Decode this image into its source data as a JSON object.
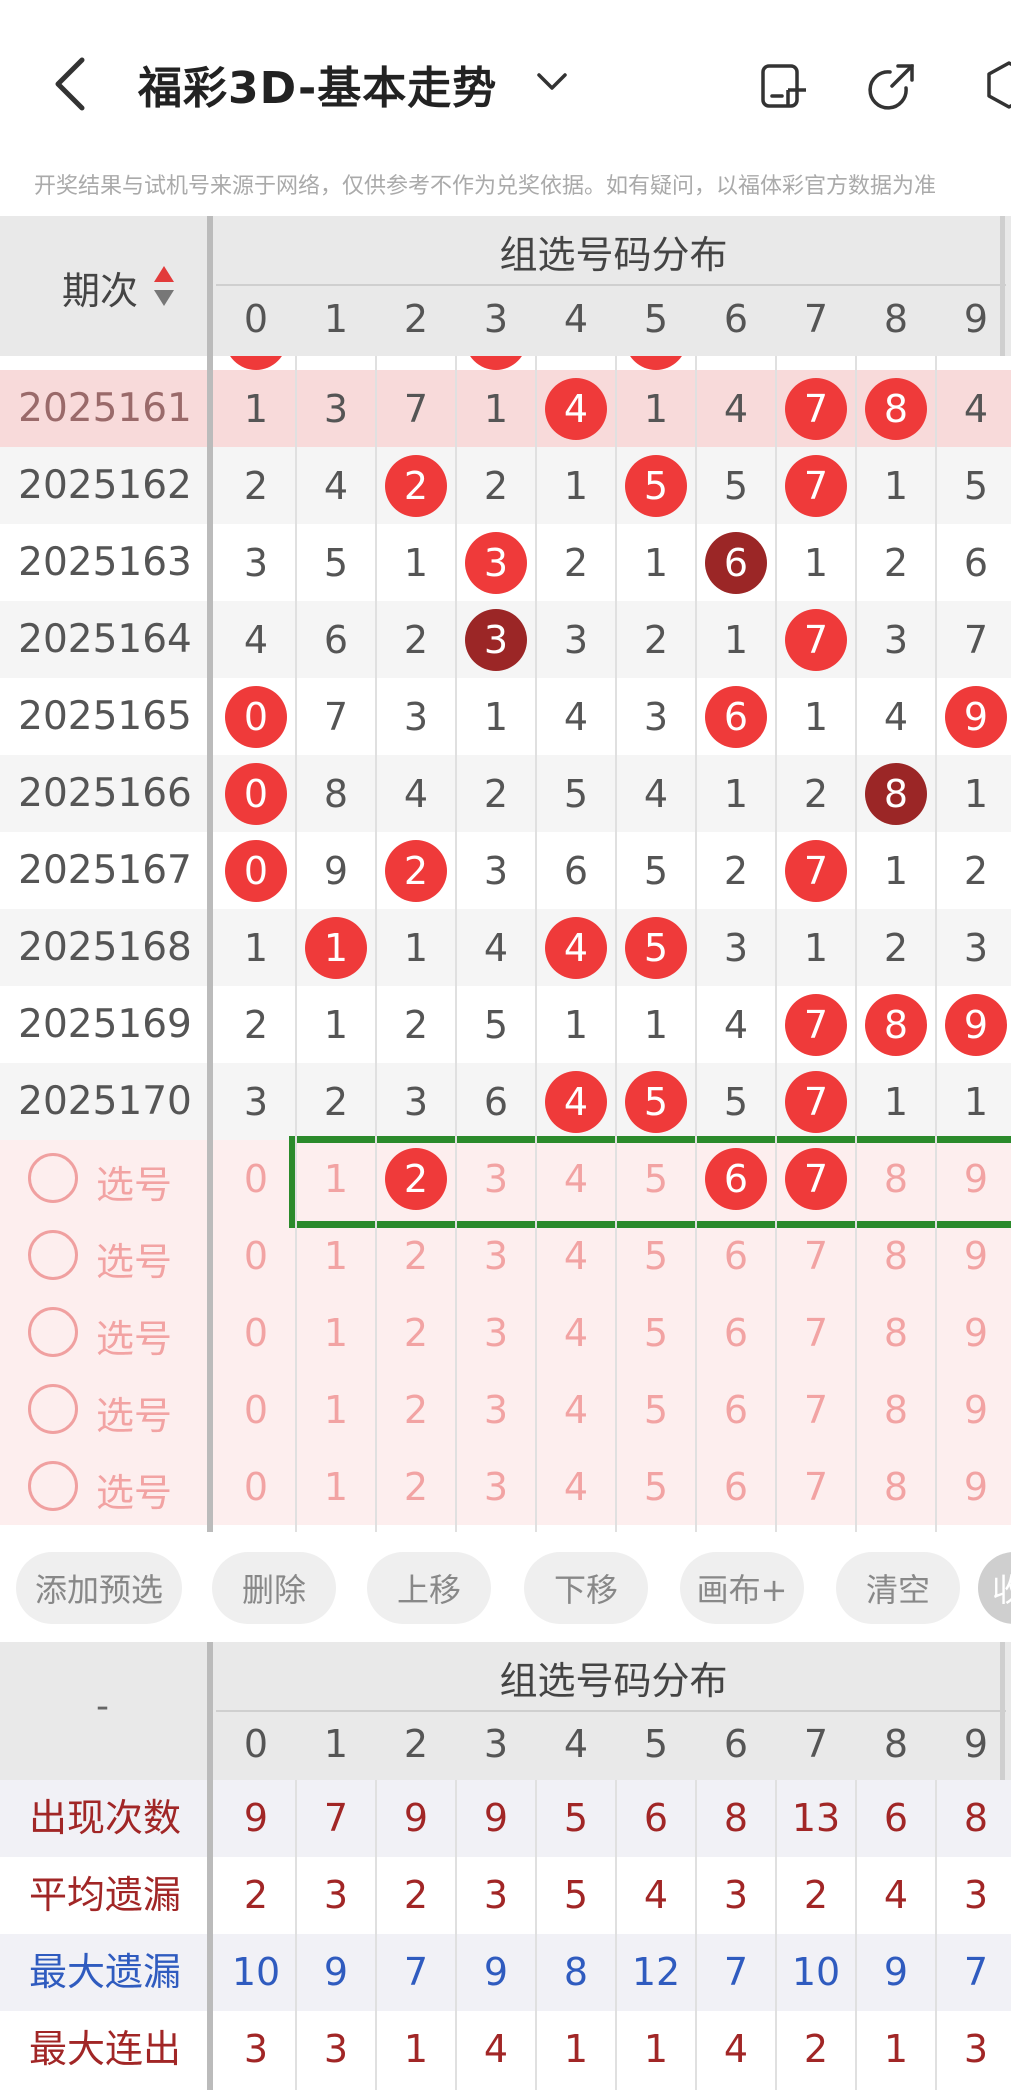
{
  "header": {
    "title": "福彩3D-基本走势",
    "notice": "开奖结果与试机号来源于网络，仅供参考不作为兑奖依据。如有疑问，以福体彩官方数据为准"
  },
  "table": {
    "period_header": "期次",
    "group_title": "组选号码分布",
    "digits": [
      "0",
      "1",
      "2",
      "3",
      "4",
      "5",
      "6",
      "7",
      "8",
      "9"
    ],
    "rows": [
      {
        "period": "2025161",
        "cells": [
          "1",
          "3",
          "7",
          "1",
          "4",
          "1",
          "4",
          "7",
          "8",
          "4"
        ],
        "hits": [
          4,
          7,
          8
        ],
        "dark": []
      },
      {
        "period": "2025162",
        "cells": [
          "2",
          "4",
          "2",
          "2",
          "1",
          "5",
          "5",
          "7",
          "1",
          "5"
        ],
        "hits": [
          2,
          5,
          7
        ],
        "dark": []
      },
      {
        "period": "2025163",
        "cells": [
          "3",
          "5",
          "1",
          "3",
          "2",
          "1",
          "6",
          "1",
          "2",
          "6"
        ],
        "hits": [
          3
        ],
        "dark": [
          6
        ]
      },
      {
        "period": "2025164",
        "cells": [
          "4",
          "6",
          "2",
          "3",
          "3",
          "2",
          "1",
          "7",
          "3",
          "7"
        ],
        "hits": [
          7
        ],
        "dark": [
          3
        ]
      },
      {
        "period": "2025165",
        "cells": [
          "0",
          "7",
          "3",
          "1",
          "4",
          "3",
          "6",
          "1",
          "4",
          "9"
        ],
        "hits": [
          0,
          6,
          9
        ],
        "dark": []
      },
      {
        "period": "2025166",
        "cells": [
          "0",
          "8",
          "4",
          "2",
          "5",
          "4",
          "1",
          "2",
          "8",
          "1"
        ],
        "hits": [
          0
        ],
        "dark": [
          8
        ]
      },
      {
        "period": "2025167",
        "cells": [
          "0",
          "9",
          "2",
          "3",
          "6",
          "5",
          "2",
          "7",
          "1",
          "2"
        ],
        "hits": [
          0,
          2,
          7
        ],
        "dark": []
      },
      {
        "period": "2025168",
        "cells": [
          "1",
          "1",
          "1",
          "4",
          "4",
          "5",
          "3",
          "1",
          "2",
          "3"
        ],
        "hits": [
          1,
          4,
          5
        ],
        "dark": []
      },
      {
        "period": "2025169",
        "cells": [
          "2",
          "1",
          "2",
          "5",
          "1",
          "1",
          "4",
          "7",
          "8",
          "9"
        ],
        "hits": [
          7,
          8,
          9
        ],
        "dark": []
      },
      {
        "period": "2025170",
        "cells": [
          "3",
          "2",
          "3",
          "6",
          "4",
          "5",
          "5",
          "7",
          "1",
          "1"
        ],
        "hits": [
          4,
          5,
          7
        ],
        "dark": []
      }
    ]
  },
  "selection": {
    "label": "选号",
    "rows": [
      {
        "selected": [
          2,
          6,
          7
        ]
      },
      {
        "selected": []
      },
      {
        "selected": []
      },
      {
        "selected": []
      },
      {
        "selected": []
      }
    ]
  },
  "toolbar": {
    "buttons": [
      "添加预选",
      "删除",
      "上移",
      "下移",
      "画布+",
      "清空",
      "收"
    ]
  },
  "stats": {
    "corner": "-",
    "group_title": "组选号码分布",
    "digits": [
      "0",
      "1",
      "2",
      "3",
      "4",
      "5",
      "6",
      "7",
      "8",
      "9"
    ],
    "rows": [
      {
        "label": "出现次数",
        "values": [
          "9",
          "7",
          "9",
          "9",
          "5",
          "6",
          "8",
          "13",
          "6",
          "8"
        ]
      },
      {
        "label": "平均遗漏",
        "values": [
          "2",
          "3",
          "2",
          "3",
          "5",
          "4",
          "3",
          "2",
          "4",
          "3"
        ]
      },
      {
        "label": "最大遗漏",
        "values": [
          "10",
          "9",
          "7",
          "9",
          "8",
          "12",
          "7",
          "10",
          "9",
          "7"
        ]
      },
      {
        "label": "最大连出",
        "values": [
          "3",
          "3",
          "1",
          "4",
          "1",
          "1",
          "4",
          "2",
          "1",
          "3"
        ]
      }
    ]
  },
  "colors": {
    "ball_red": "#ef3a3a",
    "ball_dark": "#9b2626",
    "highlight_row": "#f8dada",
    "select_bg": "#fdeeee",
    "frame_green": "#2b8a2b",
    "stat_red": "#a12626",
    "stat_blue": "#2f5bbf"
  }
}
